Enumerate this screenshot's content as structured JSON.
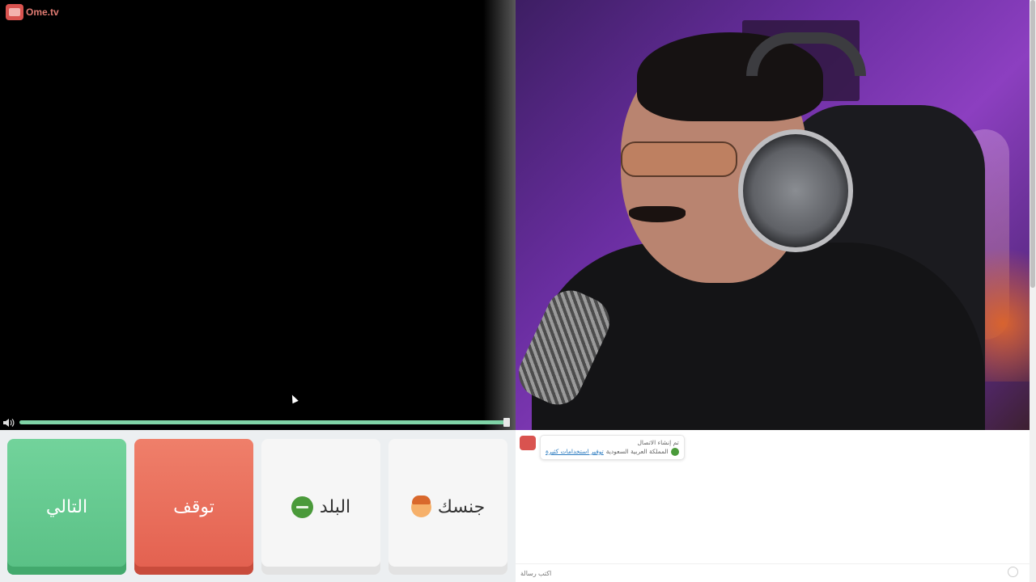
{
  "brand": {
    "logo_text": "Ome.tv"
  },
  "video": {
    "volume_level": 1.0
  },
  "controls": {
    "next_label": "التالي",
    "stop_label": "توقف",
    "country_label": "البلد",
    "gender_label": "جنسك"
  },
  "chat": {
    "messages": [
      {
        "line1": "تم إنشاء الاتصال",
        "link_text": "توفير استخدامات كثيرة",
        "country_text": "المملكة العربية السعودية"
      }
    ],
    "input_placeholder": "اكتب رسالة"
  },
  "colors": {
    "next_button": "#59c085",
    "stop_button": "#e3604f",
    "volume_fill": "#7fd3a6"
  },
  "icons": [
    "speaker-icon",
    "saudi-flag-icon",
    "boy-icon",
    "ome-logo-icon",
    "emoji-icon"
  ]
}
